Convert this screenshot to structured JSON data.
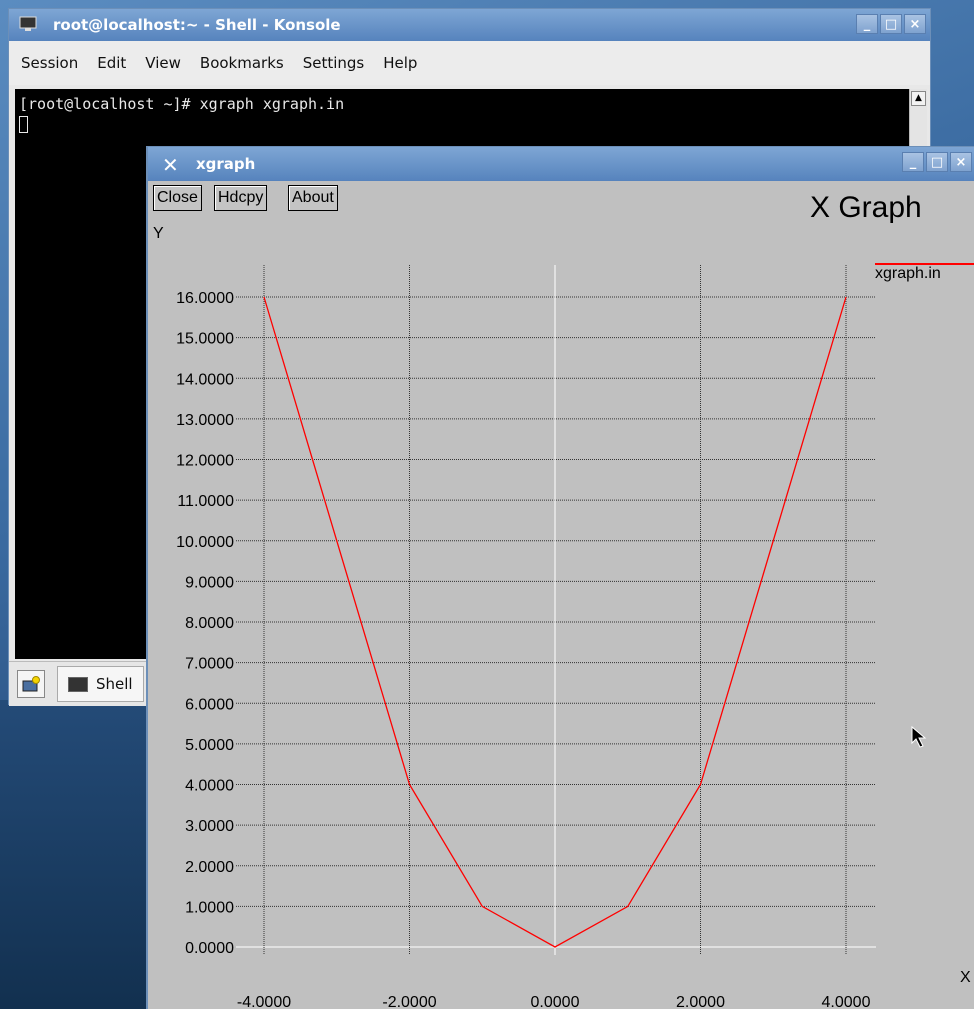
{
  "konsole": {
    "title": "root@localhost:~ - Shell - Konsole",
    "menu": [
      "Session",
      "Edit",
      "View",
      "Bookmarks",
      "Settings",
      "Help"
    ],
    "terminal_line": "[root@localhost ~]# xgraph xgraph.in",
    "tab_label": "Shell"
  },
  "xgraph": {
    "title": "xgraph",
    "buttons": {
      "close": "Close",
      "hdcpy": "Hdcpy",
      "about": "About"
    },
    "graph_title": "X Graph",
    "y_axis_label": "Y",
    "x_axis_label": "X",
    "legend": "xgraph.in"
  },
  "chart_data": {
    "type": "line",
    "title": "X Graph",
    "xlabel": "X",
    "ylabel": "Y",
    "xlim": [
      -4,
      4
    ],
    "ylim": [
      0,
      16
    ],
    "x_ticks": [
      "-4.0000",
      "-2.0000",
      "0.0000",
      "2.0000",
      "4.0000"
    ],
    "y_ticks": [
      "0.0000",
      "1.0000",
      "2.0000",
      "3.0000",
      "4.0000",
      "5.0000",
      "6.0000",
      "7.0000",
      "8.0000",
      "9.0000",
      "10.0000",
      "11.0000",
      "12.0000",
      "13.0000",
      "14.0000",
      "15.0000",
      "16.0000"
    ],
    "grid": true,
    "legend_position": "top-right",
    "series": [
      {
        "name": "xgraph.in",
        "color": "#ff0000",
        "x": [
          -4,
          -2,
          -1,
          0,
          1,
          2,
          4
        ],
        "y": [
          16,
          4,
          1,
          0,
          1,
          4,
          16
        ]
      }
    ]
  }
}
